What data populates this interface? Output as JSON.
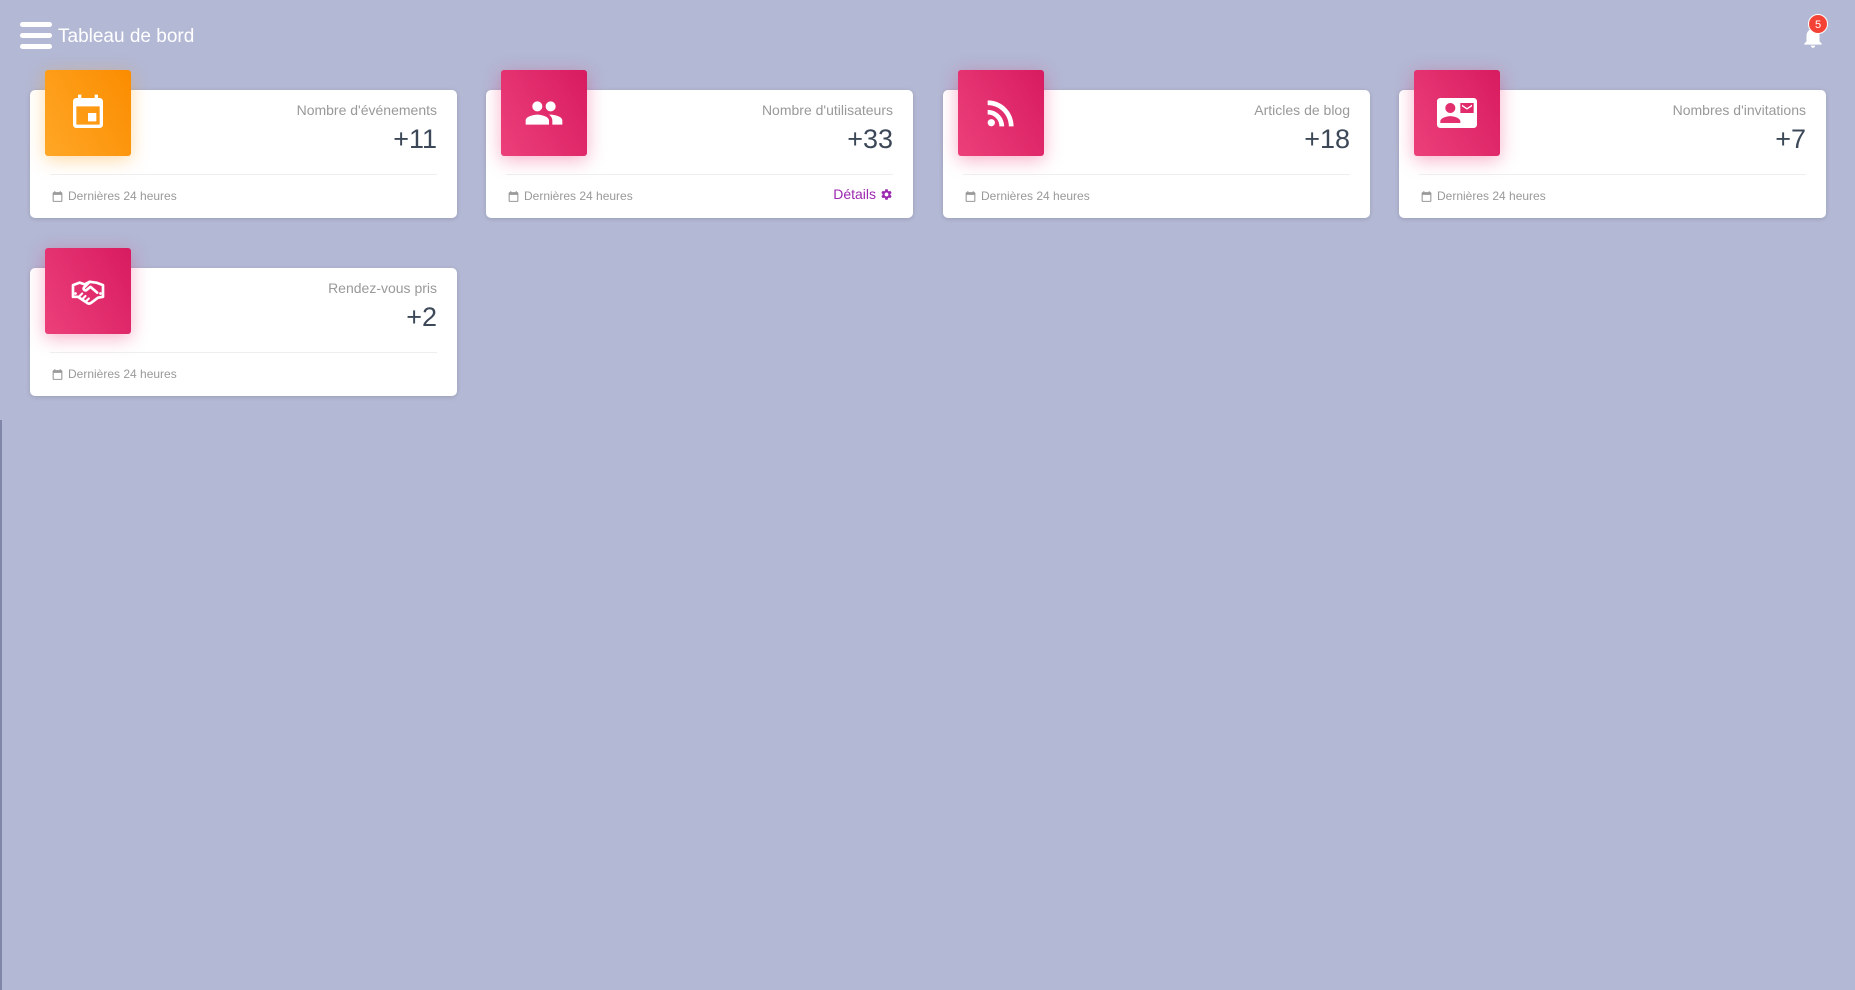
{
  "header": {
    "title": "Tableau de bord",
    "notification_count": "5"
  },
  "icons": {
    "menu": "hamburger-menu-icon",
    "bell": "bell-icon",
    "footer": "calendar-icon",
    "details": "gear-icon"
  },
  "colors": {
    "background": "#b3b8d4",
    "orange_accent": "#fb8c00",
    "pink_accent": "#e91e63",
    "link": "#9c27b0",
    "badge": "#f44336"
  },
  "cards": [
    {
      "category": "Nombre d'événements",
      "value": "+11",
      "footer": "Dernières 24 heures",
      "icon": "event-calendar-icon",
      "color": "orange"
    },
    {
      "category": "Nombre d'utilisateurs",
      "value": "+33",
      "footer": "Dernières 24 heures",
      "icon": "users-icon",
      "color": "pink",
      "link": "Détails"
    },
    {
      "category": "Articles de blog",
      "value": "+18",
      "footer": "Dernières 24 heures",
      "icon": "rss-feed-icon",
      "color": "pink"
    },
    {
      "category": "Nombres d'invitations",
      "value": "+7",
      "footer": "Dernières 24 heures",
      "icon": "contact-mail-icon",
      "color": "pink"
    },
    {
      "category": "Rendez-vous pris",
      "value": "+2",
      "footer": "Dernières 24 heures",
      "icon": "handshake-icon",
      "color": "pink"
    }
  ]
}
